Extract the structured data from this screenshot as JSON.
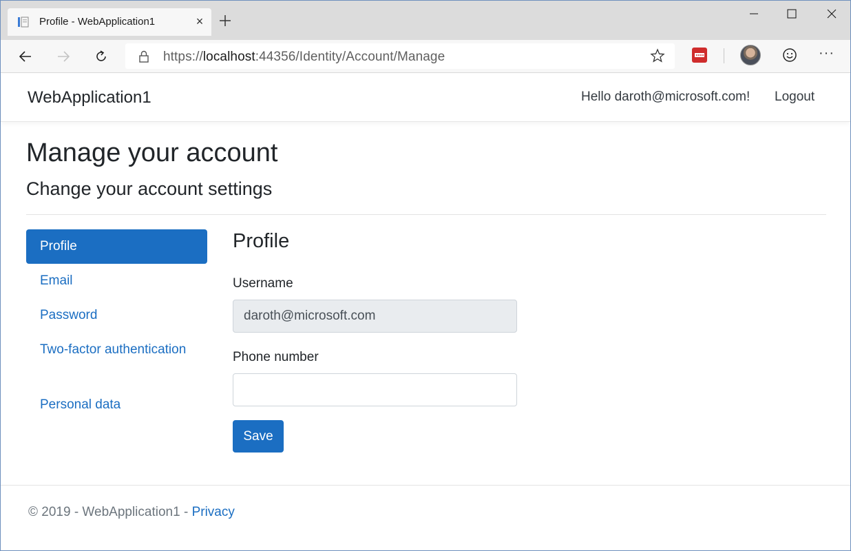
{
  "browser": {
    "tab_title": "Profile - WebApplication1",
    "url_prefix": "https://",
    "url_host": "localhost",
    "url_rest": ":44356/Identity/Account/Manage"
  },
  "navbar": {
    "brand": "WebApplication1",
    "hello": "Hello daroth@microsoft.com!",
    "logout": "Logout"
  },
  "page": {
    "title": "Manage your account",
    "subtitle": "Change your account settings"
  },
  "sidenav": {
    "items": [
      {
        "label": "Profile"
      },
      {
        "label": "Email"
      },
      {
        "label": "Password"
      },
      {
        "label": "Two-factor authentication"
      },
      {
        "label": "Personal data"
      }
    ]
  },
  "form": {
    "heading": "Profile",
    "username_label": "Username",
    "username_value": "daroth@microsoft.com",
    "phone_label": "Phone number",
    "phone_value": "",
    "save_label": "Save"
  },
  "footer": {
    "text": "© 2019 - WebApplication1 - ",
    "privacy": "Privacy"
  },
  "colors": {
    "primary": "#1b6ec2",
    "disabled_input": "#e9ecef"
  }
}
